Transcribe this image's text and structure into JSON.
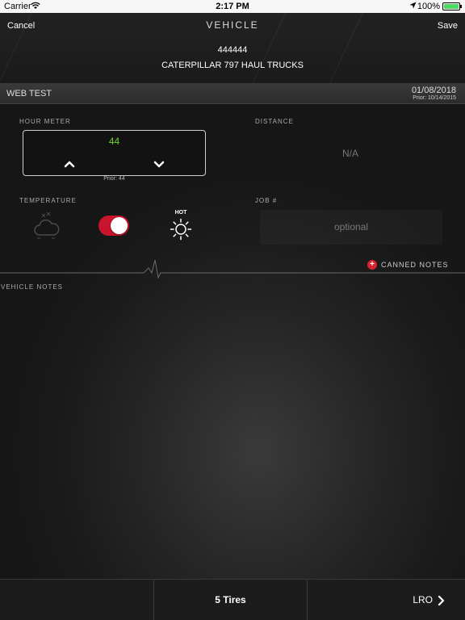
{
  "status_bar": {
    "carrier": "Carrier",
    "time": "2:17 PM",
    "battery": "100%",
    "battery_color": "#4cd964"
  },
  "header": {
    "cancel_label": "Cancel",
    "title": "VEHICLE",
    "save_label": "Save",
    "vehicle_id": "444444",
    "vehicle_model": "CATERPILLAR 797 HAUL TRUCKS"
  },
  "site_bar": {
    "name": "WEB TEST",
    "date": "01/08/2018",
    "prior": "Prior: 10/14/2015"
  },
  "hour_meter": {
    "label": "HOUR METER",
    "value": "44",
    "prior": "Prior: 44",
    "value_color": "#6fd12f",
    "up_icon": "chevron-up-icon",
    "down_icon": "chevron-down-icon"
  },
  "distance": {
    "label": "DISTANCE",
    "value": "N/A"
  },
  "temperature": {
    "label": "TEMPERATURE",
    "hot_label": "HOT",
    "toggle_on": true,
    "toggle_color": "#c8142c",
    "cold_icon": "snow-cloud-icon",
    "hot_icon": "sun-icon"
  },
  "job": {
    "label": "JOB #",
    "placeholder": "optional"
  },
  "canned_notes": {
    "label": "CANNED NOTES",
    "icon": "plus-circle-icon",
    "icon_color": "#d6232f"
  },
  "notes": {
    "label": "VEHICLE NOTES"
  },
  "bottom_bar": {
    "tires_label": "5 Tires",
    "next_label": "LRO",
    "next_icon": "chevron-right-icon"
  }
}
